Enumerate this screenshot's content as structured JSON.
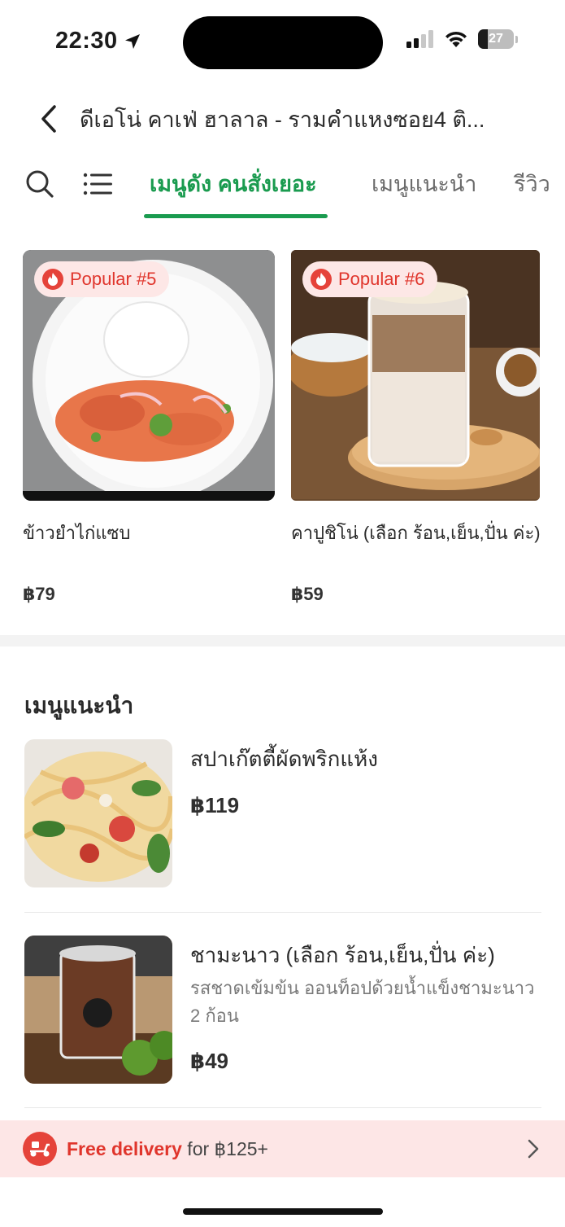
{
  "status": {
    "time": "22:30",
    "battery": "27"
  },
  "header": {
    "title": "ดีเอโน่ คาเฟ่ ฮาลาล - รามคำแหงซอย4 ติ..."
  },
  "tabs": [
    {
      "label": "เมนูดัง คนสั่งเยอะ",
      "active": true
    },
    {
      "label": "เมนูแนะนำ",
      "active": false
    },
    {
      "label": "รีวิว",
      "active": false
    }
  ],
  "popular": [
    {
      "badge": "Popular #5",
      "name": "ข้าวยำไก่แซบ",
      "price": "฿79"
    },
    {
      "badge": "Popular #6",
      "name": "คาปูชิโน่  (เลือก ร้อน,เย็น,ปั่น ค่ะ)",
      "price": "฿59"
    }
  ],
  "recommended": {
    "title": "เมนูแนะนำ",
    "items": [
      {
        "name": "สปาเก๊ตตี้ผัดพริกแห้ง",
        "description": "",
        "price": "฿119"
      },
      {
        "name": "ชามะนาว (เลือก ร้อน,เย็น,ปั่น ค่ะ)",
        "description": "รสชาดเข้มข้น ออนท็อปด้วยน้ำแข็งชามะนาว 2 ก้อน",
        "price": "฿49"
      }
    ]
  },
  "delivery": {
    "accent": "Free delivery",
    "rest": " for ฿125+"
  },
  "colors": {
    "brand_green": "#1a9b4f",
    "badge_red": "#e0352c",
    "banner_bg": "#fde6e6"
  }
}
